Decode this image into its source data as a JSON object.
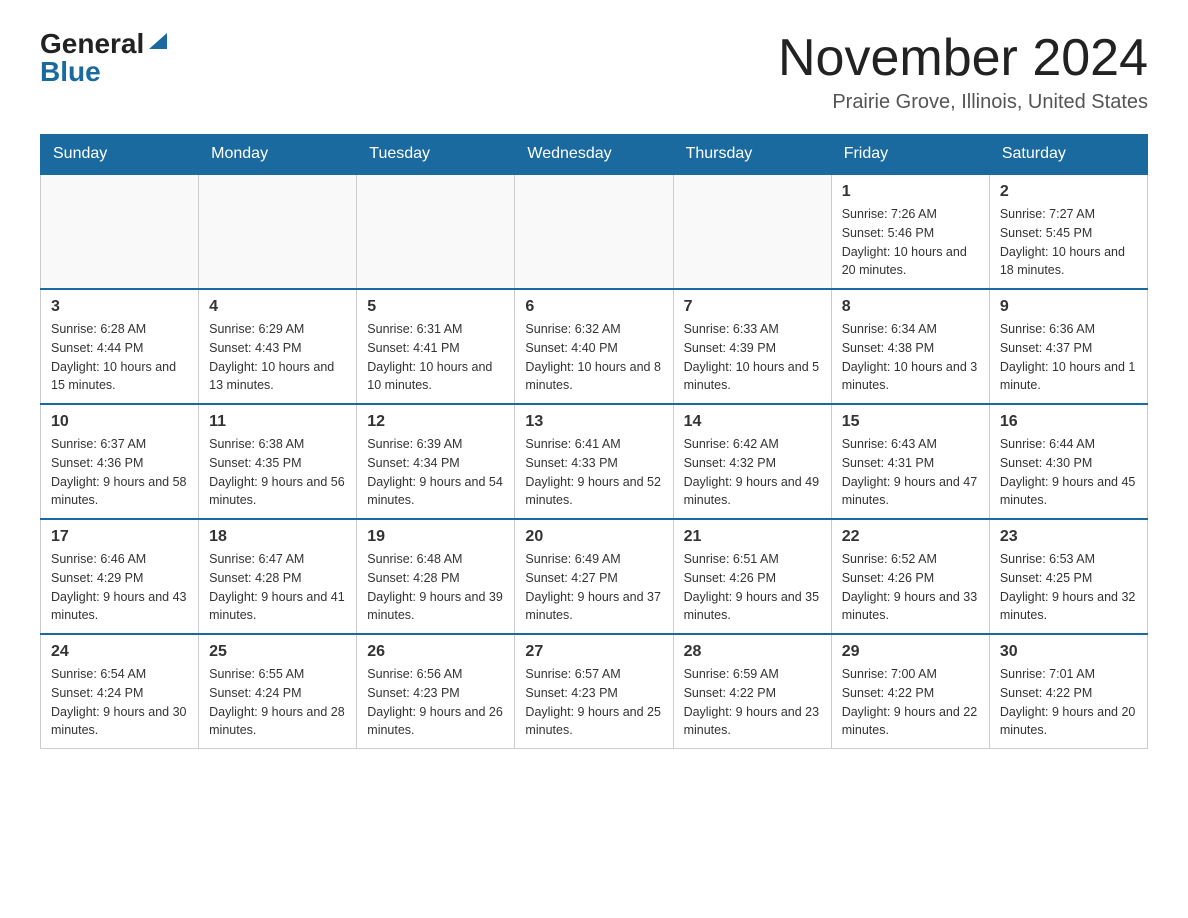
{
  "logo": {
    "general": "General",
    "blue": "Blue"
  },
  "title": "November 2024",
  "subtitle": "Prairie Grove, Illinois, United States",
  "days_of_week": [
    "Sunday",
    "Monday",
    "Tuesday",
    "Wednesday",
    "Thursday",
    "Friday",
    "Saturday"
  ],
  "weeks": [
    [
      {
        "day": "",
        "info": ""
      },
      {
        "day": "",
        "info": ""
      },
      {
        "day": "",
        "info": ""
      },
      {
        "day": "",
        "info": ""
      },
      {
        "day": "",
        "info": ""
      },
      {
        "day": "1",
        "info": "Sunrise: 7:26 AM\nSunset: 5:46 PM\nDaylight: 10 hours and 20 minutes."
      },
      {
        "day": "2",
        "info": "Sunrise: 7:27 AM\nSunset: 5:45 PM\nDaylight: 10 hours and 18 minutes."
      }
    ],
    [
      {
        "day": "3",
        "info": "Sunrise: 6:28 AM\nSunset: 4:44 PM\nDaylight: 10 hours and 15 minutes."
      },
      {
        "day": "4",
        "info": "Sunrise: 6:29 AM\nSunset: 4:43 PM\nDaylight: 10 hours and 13 minutes."
      },
      {
        "day": "5",
        "info": "Sunrise: 6:31 AM\nSunset: 4:41 PM\nDaylight: 10 hours and 10 minutes."
      },
      {
        "day": "6",
        "info": "Sunrise: 6:32 AM\nSunset: 4:40 PM\nDaylight: 10 hours and 8 minutes."
      },
      {
        "day": "7",
        "info": "Sunrise: 6:33 AM\nSunset: 4:39 PM\nDaylight: 10 hours and 5 minutes."
      },
      {
        "day": "8",
        "info": "Sunrise: 6:34 AM\nSunset: 4:38 PM\nDaylight: 10 hours and 3 minutes."
      },
      {
        "day": "9",
        "info": "Sunrise: 6:36 AM\nSunset: 4:37 PM\nDaylight: 10 hours and 1 minute."
      }
    ],
    [
      {
        "day": "10",
        "info": "Sunrise: 6:37 AM\nSunset: 4:36 PM\nDaylight: 9 hours and 58 minutes."
      },
      {
        "day": "11",
        "info": "Sunrise: 6:38 AM\nSunset: 4:35 PM\nDaylight: 9 hours and 56 minutes."
      },
      {
        "day": "12",
        "info": "Sunrise: 6:39 AM\nSunset: 4:34 PM\nDaylight: 9 hours and 54 minutes."
      },
      {
        "day": "13",
        "info": "Sunrise: 6:41 AM\nSunset: 4:33 PM\nDaylight: 9 hours and 52 minutes."
      },
      {
        "day": "14",
        "info": "Sunrise: 6:42 AM\nSunset: 4:32 PM\nDaylight: 9 hours and 49 minutes."
      },
      {
        "day": "15",
        "info": "Sunrise: 6:43 AM\nSunset: 4:31 PM\nDaylight: 9 hours and 47 minutes."
      },
      {
        "day": "16",
        "info": "Sunrise: 6:44 AM\nSunset: 4:30 PM\nDaylight: 9 hours and 45 minutes."
      }
    ],
    [
      {
        "day": "17",
        "info": "Sunrise: 6:46 AM\nSunset: 4:29 PM\nDaylight: 9 hours and 43 minutes."
      },
      {
        "day": "18",
        "info": "Sunrise: 6:47 AM\nSunset: 4:28 PM\nDaylight: 9 hours and 41 minutes."
      },
      {
        "day": "19",
        "info": "Sunrise: 6:48 AM\nSunset: 4:28 PM\nDaylight: 9 hours and 39 minutes."
      },
      {
        "day": "20",
        "info": "Sunrise: 6:49 AM\nSunset: 4:27 PM\nDaylight: 9 hours and 37 minutes."
      },
      {
        "day": "21",
        "info": "Sunrise: 6:51 AM\nSunset: 4:26 PM\nDaylight: 9 hours and 35 minutes."
      },
      {
        "day": "22",
        "info": "Sunrise: 6:52 AM\nSunset: 4:26 PM\nDaylight: 9 hours and 33 minutes."
      },
      {
        "day": "23",
        "info": "Sunrise: 6:53 AM\nSunset: 4:25 PM\nDaylight: 9 hours and 32 minutes."
      }
    ],
    [
      {
        "day": "24",
        "info": "Sunrise: 6:54 AM\nSunset: 4:24 PM\nDaylight: 9 hours and 30 minutes."
      },
      {
        "day": "25",
        "info": "Sunrise: 6:55 AM\nSunset: 4:24 PM\nDaylight: 9 hours and 28 minutes."
      },
      {
        "day": "26",
        "info": "Sunrise: 6:56 AM\nSunset: 4:23 PM\nDaylight: 9 hours and 26 minutes."
      },
      {
        "day": "27",
        "info": "Sunrise: 6:57 AM\nSunset: 4:23 PM\nDaylight: 9 hours and 25 minutes."
      },
      {
        "day": "28",
        "info": "Sunrise: 6:59 AM\nSunset: 4:22 PM\nDaylight: 9 hours and 23 minutes."
      },
      {
        "day": "29",
        "info": "Sunrise: 7:00 AM\nSunset: 4:22 PM\nDaylight: 9 hours and 22 minutes."
      },
      {
        "day": "30",
        "info": "Sunrise: 7:01 AM\nSunset: 4:22 PM\nDaylight: 9 hours and 20 minutes."
      }
    ]
  ]
}
